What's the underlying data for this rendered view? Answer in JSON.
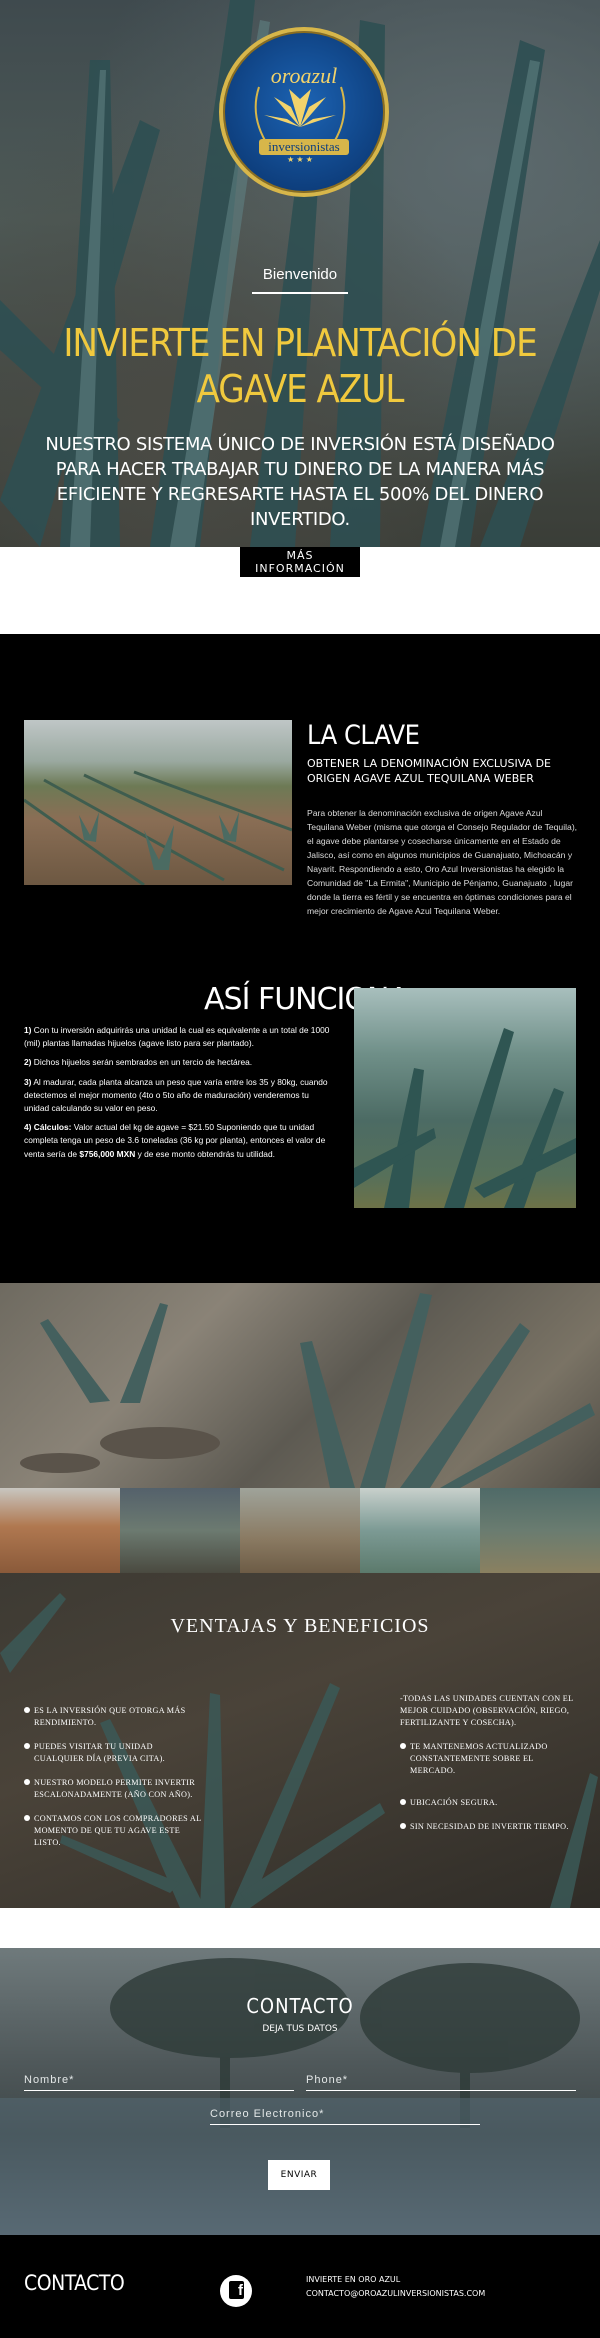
{
  "hero": {
    "logo_brand": "oroazul",
    "logo_sub": "inversionistas",
    "welcome": "Bienvenido",
    "title": "INVIERTE EN PLANTACIÓN DE AGAVE AZUL",
    "text": "NUESTRO SISTEMA ÚNICO DE INVERSIÓN ESTÁ DISEÑADO PARA HACER TRABAJAR TU DINERO DE LA MANERA MÁS EFICIENTE Y REGRESARTE HASTA EL 500% DEL DINERO INVERTIDO.",
    "button": "MÁS INFORMACIÓN"
  },
  "clave": {
    "title": "LA CLAVE",
    "subtitle": "OBTENER LA DENOMINACIÓN EXCLUSIVA DE ORIGEN AGAVE AZUL TEQUILANA WEBER",
    "body": "Para obtener la denominación exclusiva de origen Agave Azul Tequilana Weber (misma que otorga el Consejo Regulador de Tequila), el agave debe plantarse y cosecharse únicamente en el Estado de Jalisco, así como en algunos municipios de Guanajuato, Michoacán y Nayarit. Respondiendo a esto, Oro Azul Inversionistas ha elegido la Comunidad de \"La Ermita\", Municipio de Pénjamo, Guanajuato , lugar donde la tierra es fértil y se encuentra en óptimas condiciones para el mejor crecimiento de Agave Azul Tequilana Weber."
  },
  "asi": {
    "title": "ASÍ FUNCIONA",
    "items": [
      {
        "num": "1)",
        "text": " Con tu inversión adquirirás una unidad la cual es equivalente a un total de 1000 (mil) plantas llamadas hijuelos (agave listo para ser plantado)."
      },
      {
        "num": "2)",
        "text": " Dichos hijuelos serán sembrados en un tercio de hectárea."
      },
      {
        "num": "3)",
        "text": " Al madurar, cada planta alcanza un peso que varía entre los 35 y 80kg, cuando detectemos el mejor momento (4to o 5to año de maduración) venderemos tu unidad calculando su valor en peso."
      },
      {
        "num": "4) Cálculos:",
        "text": " Valor actual del kg de agave = $21.50 Suponiendo que tu unidad completa tenga un peso de 3.6 toneladas (36 kg por planta), entonces el valor de venta sería de ",
        "bold2": "$756,000 MXN",
        "text2": " y de ese monto obtendrás tu utilidad."
      }
    ]
  },
  "ventajas": {
    "title": "VENTAJAS Y BENEFICIOS",
    "left": [
      "ES LA INVERSIÓN QUE OTORGA MÁS RENDIMIENTO.",
      "PUEDES VISITAR TU UNIDAD CUALQUIER DÍA (PREVIA CITA).",
      "NUESTRO MODELO PERMITE INVERTIR ESCALONADAMENTE (AÑO CON AÑO).",
      "CONTAMOS CON LOS COMPRADORES AL MOMENTO DE QUE TU AGAVE ESTE LISTO."
    ],
    "right_intro": "-TODAS LAS UNIDADES CUENTAN CON EL MEJOR CUIDADO (OBSERVACIÓN, RIEGO, FERTILIZANTE Y COSECHA).",
    "right": [
      "TE MANTENEMOS ACTUALIZADO CONSTANTEMENTE SOBRE EL MERCADO.",
      "UBICACIÓN SEGURA.",
      "SIN NECESIDAD DE INVERTIR TIEMPO."
    ]
  },
  "contact": {
    "title": "CONTACTO",
    "subtitle": "DEJA TUS DATOS",
    "name_placeholder": "Nombre*",
    "phone_placeholder": "Phone*",
    "email_placeholder": "Correo Electronico*",
    "send": "ENVIAR"
  },
  "footer": {
    "title": "CONTACTO",
    "facebook_icon": "facebook-icon",
    "line1": "INVIERTE EN ORO AZUL",
    "line2": "CONTACTO@OROAZULINVERSIONISTAS.COM"
  }
}
